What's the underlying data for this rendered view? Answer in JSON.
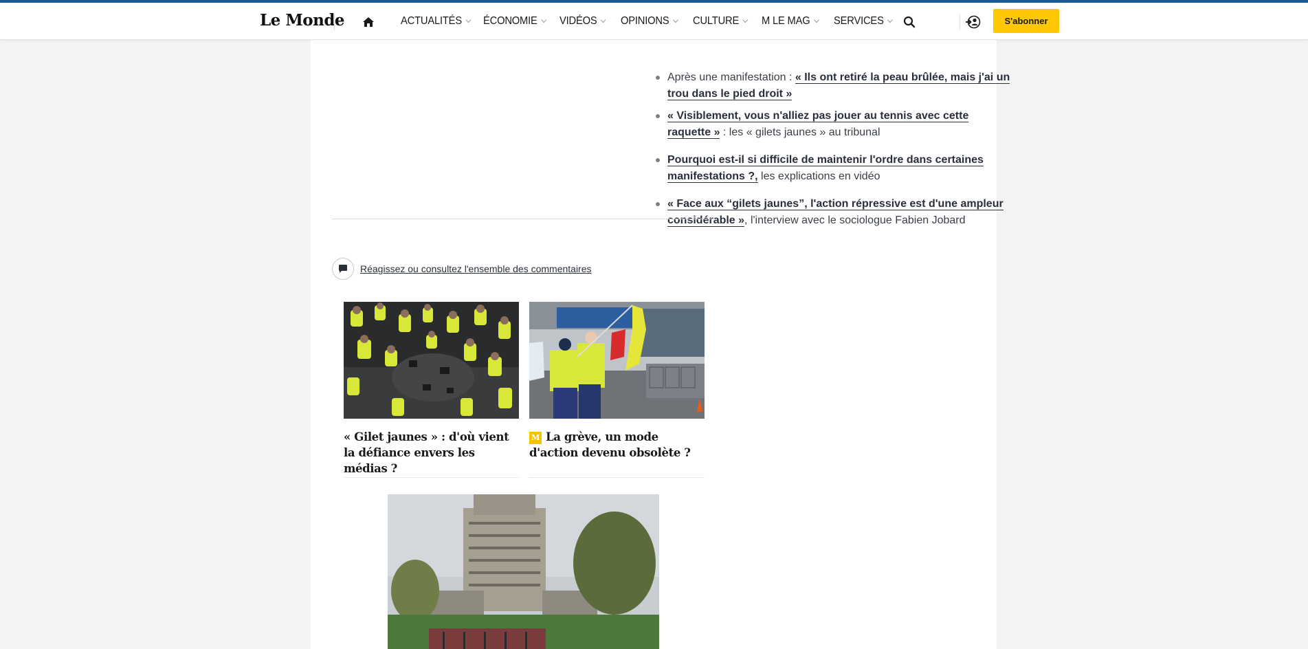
{
  "header": {
    "logo": "Le Monde",
    "nav": [
      {
        "label": "ACTUALITÉS"
      },
      {
        "label": "ÉCONOMIE"
      },
      {
        "label": "VIDÉOS"
      },
      {
        "label": "OPINIONS"
      },
      {
        "label": "CULTURE"
      },
      {
        "label": "M LE MAG"
      },
      {
        "label": "SERVICES"
      }
    ],
    "subscribe_label": "S'abonner"
  },
  "related": [
    {
      "prefix": "Après une manifestation : ",
      "link": "« Ils ont retiré la peau brûlée, mais j'ai un trou dans le pied droit »",
      "suffix": ""
    },
    {
      "prefix": "",
      "link": "« Visiblement, vous n'alliez pas jouer au tennis avec cette raquette »",
      "suffix": " : les « gilets jaunes » au tribunal"
    },
    {
      "prefix": "",
      "link": "Pourquoi est-il si difficile de maintenir l'ordre dans certaines manifestations ?,",
      "suffix": " les explications en vidéo"
    },
    {
      "prefix": "",
      "link": "« Face aux “gilets jaunes”, l'action répressive est d'une ampleur considérable »",
      "suffix": ", l'interview avec le sociologue Fabien Jobard"
    }
  ],
  "comments": {
    "link": "Réagissez ou consultez l'ensemble des commentaires"
  },
  "cards": [
    {
      "title": "« Gilet jaunes » : d'où vient la défiance envers les médias ?",
      "premium": false
    },
    {
      "title": "La grève, un mode d'action devenu obsolète ?",
      "premium": true,
      "badge": "M"
    }
  ],
  "colors": {
    "accent_bar": "#1a5a96",
    "subscribe": "#ffc800",
    "premium_badge": "#f3c300",
    "vest_yellow": "#d9e63a"
  }
}
